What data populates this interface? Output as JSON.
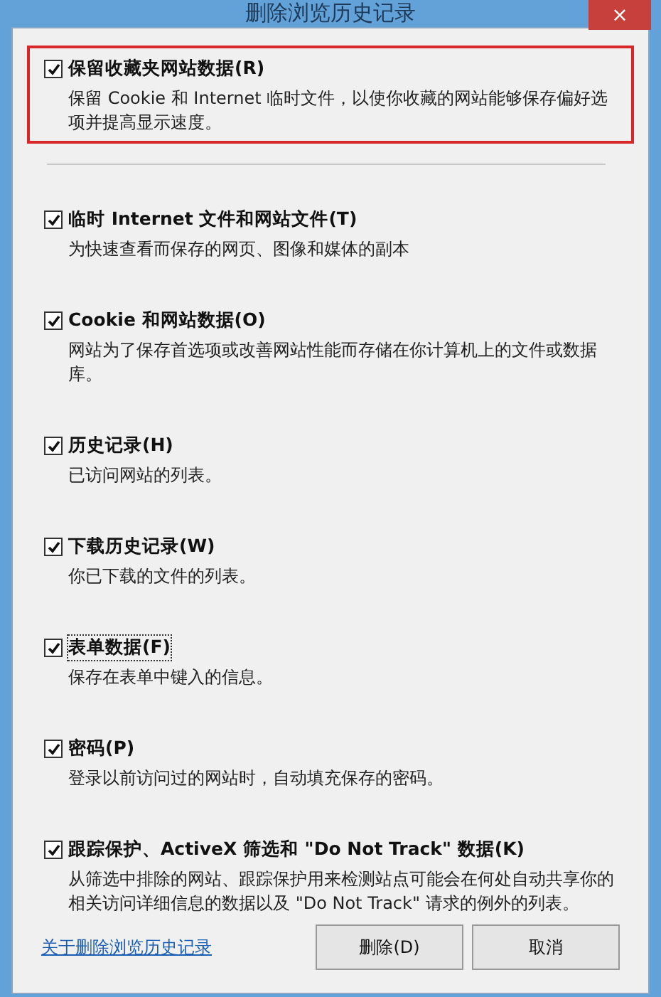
{
  "window": {
    "title": "删除浏览历史记录",
    "close": "×"
  },
  "options": [
    {
      "label": "保留收藏夹网站数据(R)",
      "description": "保留 Cookie 和 Internet 临时文件，以使你收藏的网站能够保存偏好选项并提高显示速度。",
      "checked": true,
      "highlighted": true,
      "focused": false
    },
    {
      "label": "临时 Internet 文件和网站文件(T)",
      "description": "为快速查看而保存的网页、图像和媒体的副本",
      "checked": true,
      "highlighted": false,
      "focused": false
    },
    {
      "label": "Cookie 和网站数据(O)",
      "description": "网站为了保存首选项或改善网站性能而存储在你计算机上的文件或数据库。",
      "checked": true,
      "highlighted": false,
      "focused": false
    },
    {
      "label": "历史记录(H)",
      "description": "已访问网站的列表。",
      "checked": true,
      "highlighted": false,
      "focused": false
    },
    {
      "label": "下载历史记录(W)",
      "description": "你已下载的文件的列表。",
      "checked": true,
      "highlighted": false,
      "focused": false
    },
    {
      "label": "表单数据(F)",
      "description": "保存在表单中键入的信息。",
      "checked": true,
      "highlighted": false,
      "focused": true
    },
    {
      "label": "密码(P)",
      "description": "登录以前访问过的网站时，自动填充保存的密码。",
      "checked": true,
      "highlighted": false,
      "focused": false
    },
    {
      "label": "跟踪保护、ActiveX 筛选和 \"Do Not Track\" 数据(K)",
      "description": "从筛选中排除的网站、跟踪保护用来检测站点可能会在何处自动共享你的相关访问详细信息的数据以及 \"Do Not Track\" 请求的例外的列表。",
      "checked": true,
      "highlighted": false,
      "focused": false
    }
  ],
  "footer": {
    "link": "关于删除浏览历史记录",
    "buttons": [
      "删除(D)",
      "取消"
    ]
  }
}
